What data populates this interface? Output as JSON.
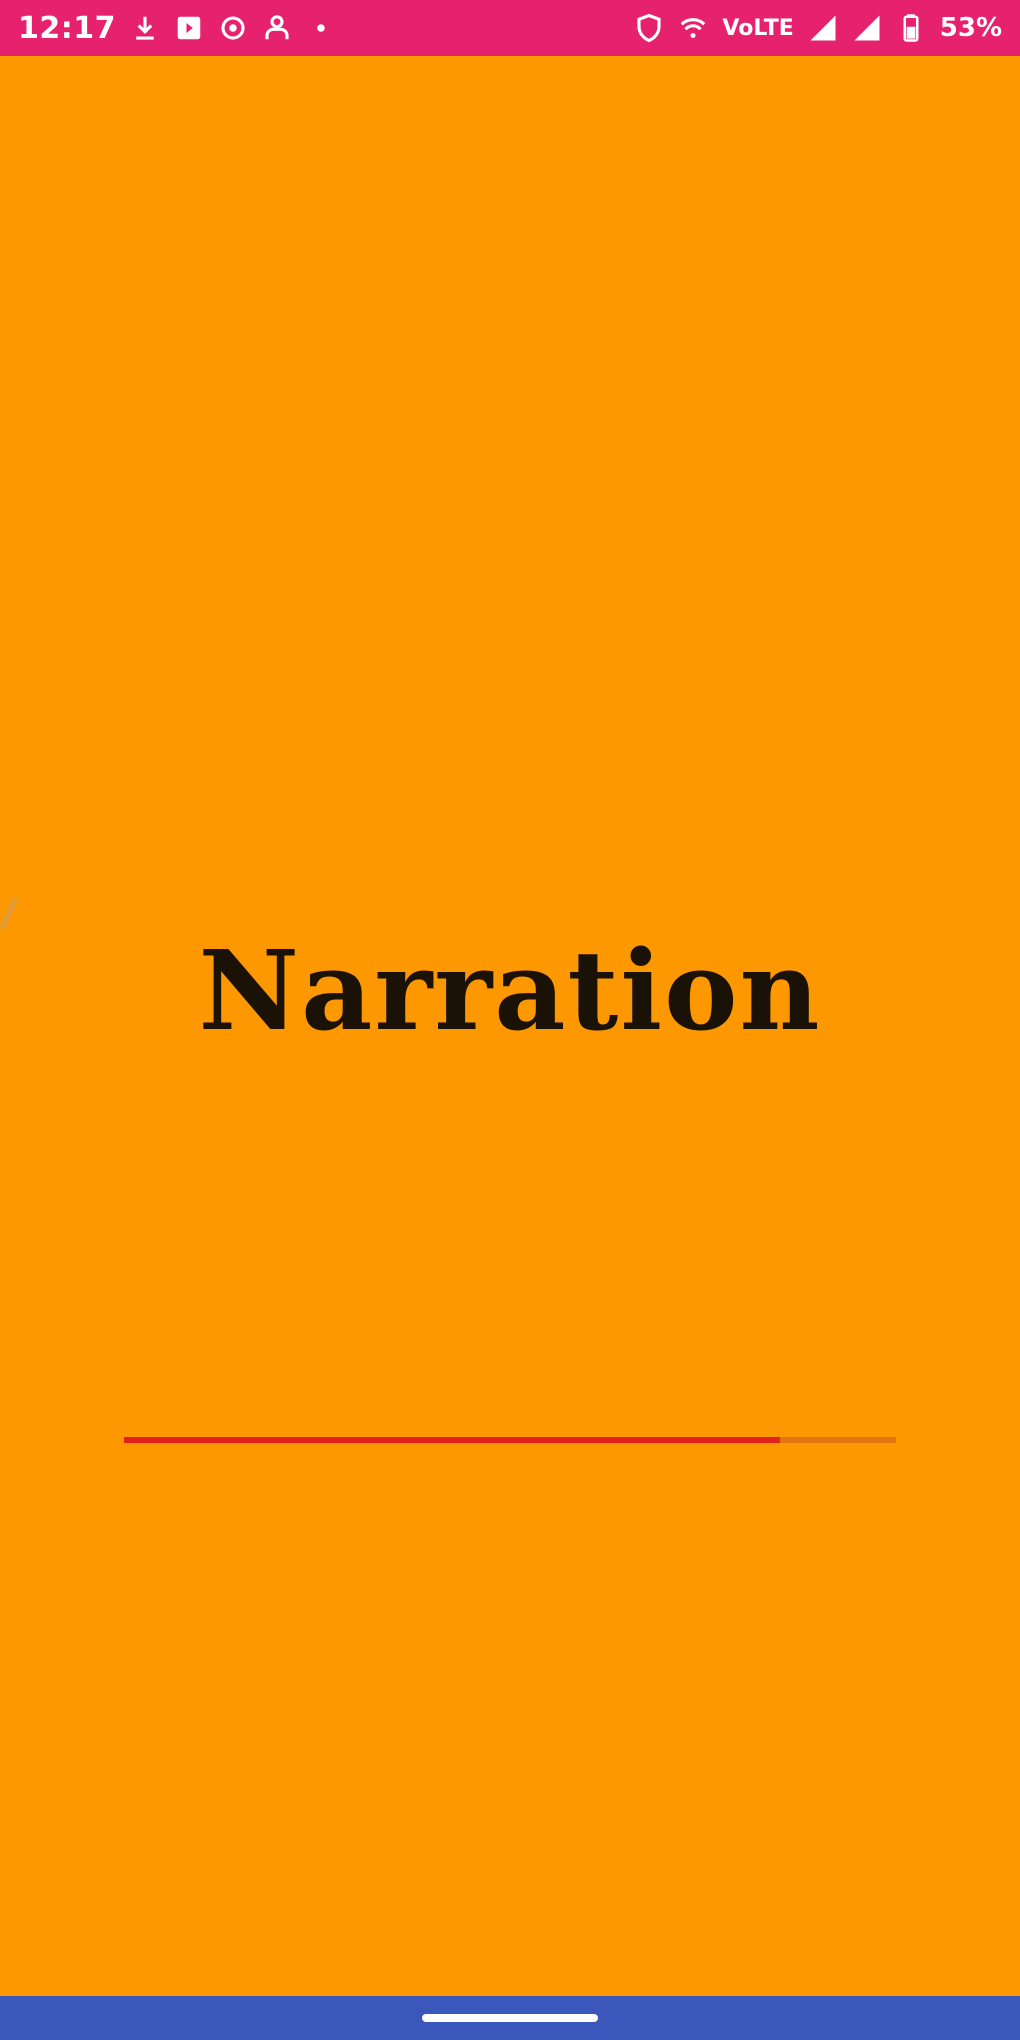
{
  "status_bar": {
    "time": "12:17",
    "network_text": "VoLTE",
    "battery_text": "53%",
    "icons": {
      "left": [
        "download-icon",
        "app-notification-icon",
        "settings-notification-icon",
        "people-icon",
        "dot-icon"
      ],
      "right": [
        "shield-icon",
        "wifi-calling-icon",
        "signal-icon",
        "signal-icon-2",
        "battery-icon"
      ]
    },
    "background_color": "#e6226e"
  },
  "splash": {
    "title": "Narration",
    "background_color": "#fe9800",
    "progress": {
      "value": 0.85,
      "fill_color": "#e2211c"
    }
  },
  "nav_bar": {
    "background_color": "#3b57bb"
  }
}
